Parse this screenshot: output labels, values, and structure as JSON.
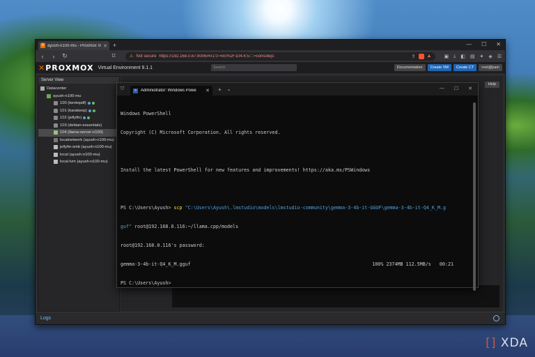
{
  "browser": {
    "tab_title": "ayush-n100-mu - Proxmox Virt",
    "security_label": "Not secure",
    "url": "https://192.168.0.87:8006/#v1:0:=lxc%2F104:4:5::::=consolejs:"
  },
  "pve": {
    "logo_text": "PROXMOX",
    "version_label": "Virtual Environment 9.1.1",
    "search_placeholder": "Search",
    "buttons": {
      "documentation": "Documentation",
      "create_vm": "Create VM",
      "create_ct": "Create CT",
      "user": "root@pam",
      "help": "Help"
    },
    "server_view_label": "Server View",
    "tree": [
      {
        "label": "Datacenter",
        "icon": "datacenter-icon"
      },
      {
        "label": "ayush-n100-mu",
        "icon": "node-icon"
      },
      {
        "label": "100 (bentopdf)",
        "icon": "container-icon"
      },
      {
        "label": "101 (karakeep)",
        "icon": "container-icon"
      },
      {
        "label": "102 (jellyfin)",
        "icon": "container-icon"
      },
      {
        "label": "103 (debian-essentials)",
        "icon": "container-icon"
      },
      {
        "label": "104 (llama-server-n100)",
        "icon": "container-icon"
      },
      {
        "label": "localnetwork (ayush-n100-mu)",
        "icon": "network-icon"
      },
      {
        "label": "jellyfin-smb (ayush-n100-mu)",
        "icon": "storage-icon"
      },
      {
        "label": "local (ayush-n100-mu)",
        "icon": "storage-icon"
      },
      {
        "label": "local-lvm (ayush-n100-mu)",
        "icon": "storage-icon"
      }
    ],
    "logs_label": "Logs"
  },
  "terminal": {
    "tab_title": "Administrator: Windows Powe",
    "lines": {
      "l1": "Windows PowerShell",
      "l2": "Copyright (C) Microsoft Corporation. All rights reserved.",
      "l3": "Install the latest PowerShell for new features and improvements! https://aka.ms/PSWindows",
      "prompt": "PS C:\\Users\\Ayush> ",
      "cmd": "scp",
      "arg1a": " \"C:\\Users\\Ayush\\.lmstudio\\models\\lmstudio-community\\gemma-3-4b-it-GGUF\\gemma-3-4b-it-Q4_K_M.g",
      "arg1b": "guf\"",
      "arg2": " root@192.168.0.116:~/llama.cpp/models",
      "l5": "root@192.168.0.116's password:",
      "file": "gemma-3-4b-it-Q4_K_M.gguf",
      "progress": "100% 2374MB 112.5MB/s   00:21",
      "l7": "PS C:\\Users\\Ayush>"
    }
  },
  "watermark": "XDA"
}
